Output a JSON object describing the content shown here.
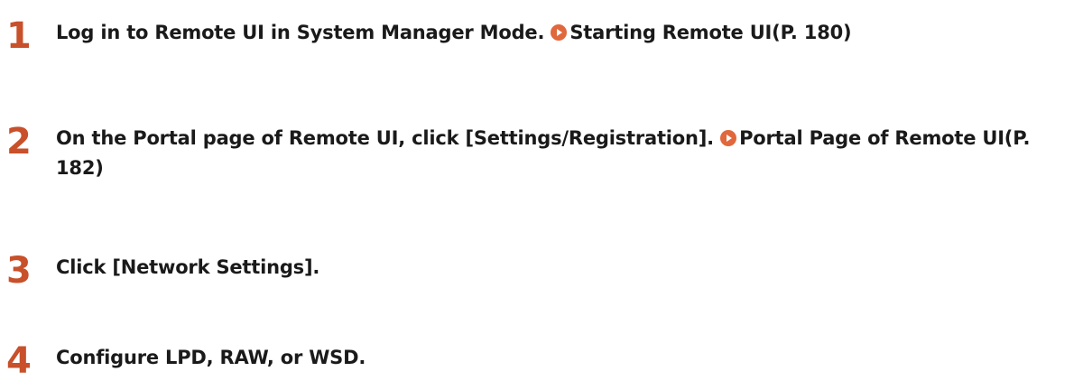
{
  "steps": [
    {
      "number": "1",
      "text": "Log in to Remote UI in System Manager Mode.",
      "link_label": "Starting Remote UI(P. 180)",
      "link_icon": "arrow-circle-icon"
    },
    {
      "number": "2",
      "text": "On the Portal page of Remote UI, click [Settings/Registration].",
      "link_label": "Portal Page of Remote UI(P. 182)",
      "link_icon": "arrow-circle-icon"
    },
    {
      "number": "3",
      "text": "Click [Network Settings]."
    },
    {
      "number": "4",
      "text": "Configure LPD, RAW, or WSD."
    }
  ],
  "colors": {
    "step_number": "#c8502a",
    "link_icon": "#e0683c",
    "text": "#1a1a1a"
  }
}
